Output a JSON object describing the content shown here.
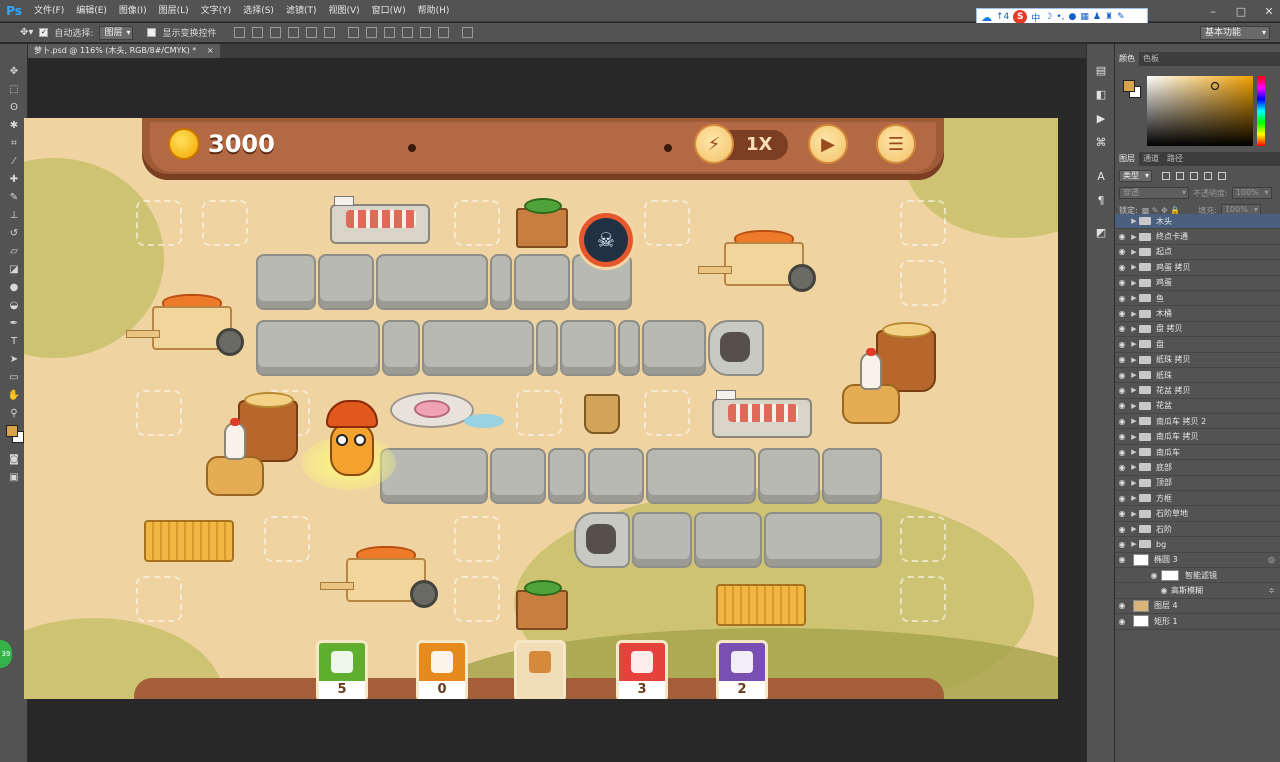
{
  "app": {
    "logo": "Ps"
  },
  "menu": [
    "文件(F)",
    "编辑(E)",
    "图像(I)",
    "图层(L)",
    "文字(Y)",
    "选择(S)",
    "滤镜(T)",
    "视图(V)",
    "窗口(W)",
    "帮助(H)"
  ],
  "ime": {
    "logo": "S",
    "lang": "中",
    "upload": "↑4"
  },
  "options": {
    "auto_select_label": "自动选择:",
    "auto_select_value": "图层",
    "show_transform_label": "显示变换控件",
    "workspace": "基本功能"
  },
  "document": {
    "tab_title": "萝卜.psd @ 116% (木头, RGB/8#/CMYK) *",
    "close": "×"
  },
  "panels": {
    "color_tabs": [
      "颜色",
      "色板"
    ],
    "layer_tabs": [
      "图层",
      "通道",
      "路径"
    ],
    "filter_type": "类型",
    "blend_mode": "穿透",
    "opacity_label": "不透明度:",
    "opacity_value": "100%",
    "lock_label": "锁定:",
    "fill_label": "填充:",
    "fill_value": "100%",
    "foreground_color": "#d8a44a",
    "background_color": "#ffffff"
  },
  "layers": [
    {
      "name": "木头",
      "type": "group",
      "visible": false,
      "selected": true
    },
    {
      "name": "终点卡通",
      "type": "group",
      "visible": true
    },
    {
      "name": "起点",
      "type": "group",
      "visible": true
    },
    {
      "name": "鸡蛋 拷贝",
      "type": "group",
      "visible": true
    },
    {
      "name": "鸡蛋",
      "type": "group",
      "visible": true
    },
    {
      "name": "鱼",
      "type": "group",
      "visible": true
    },
    {
      "name": "木桶",
      "type": "group",
      "visible": true
    },
    {
      "name": "盘 拷贝",
      "type": "group",
      "visible": true
    },
    {
      "name": "盘",
      "type": "group",
      "visible": true
    },
    {
      "name": "纸珠 拷贝",
      "type": "group",
      "visible": true
    },
    {
      "name": "纸珠",
      "type": "group",
      "visible": true
    },
    {
      "name": "花盆 拷贝",
      "type": "group",
      "visible": true
    },
    {
      "name": "花盆",
      "type": "group",
      "visible": true
    },
    {
      "name": "南瓜车 拷贝 2",
      "type": "group",
      "visible": true
    },
    {
      "name": "南瓜车 拷贝",
      "type": "group",
      "visible": true
    },
    {
      "name": "南瓜车",
      "type": "group",
      "visible": true
    },
    {
      "name": "底部",
      "type": "group",
      "visible": true
    },
    {
      "name": "顶部",
      "type": "group",
      "visible": true
    },
    {
      "name": "方框",
      "type": "group",
      "visible": true
    },
    {
      "name": "石阶草地",
      "type": "group",
      "visible": true
    },
    {
      "name": "石阶",
      "type": "group",
      "visible": true
    },
    {
      "name": "bg",
      "type": "group",
      "visible": true
    },
    {
      "name": "椭圆 3",
      "type": "smart",
      "visible": true
    },
    {
      "name": "智能滤镜",
      "type": "sub",
      "visible": true
    },
    {
      "name": "高斯模糊",
      "type": "subfilter",
      "visible": true
    },
    {
      "name": "图层 4",
      "type": "pixel-tan",
      "visible": true
    },
    {
      "name": "矩形 1",
      "type": "pixel",
      "visible": true
    }
  ],
  "game": {
    "coins": "3000",
    "speed": "1X",
    "cards": [
      {
        "name": "flag",
        "count": "5",
        "color": "#5fae2e"
      },
      {
        "name": "money-bag",
        "count": "0",
        "color": "#e78a1e"
      },
      {
        "name": "add",
        "count": "",
        "color": "#f0ddb8"
      },
      {
        "name": "bomb",
        "count": "3",
        "color": "#e4423a"
      },
      {
        "name": "cow",
        "count": "2",
        "color": "#7a4fb2"
      }
    ]
  },
  "status": {
    "badge": "39"
  }
}
